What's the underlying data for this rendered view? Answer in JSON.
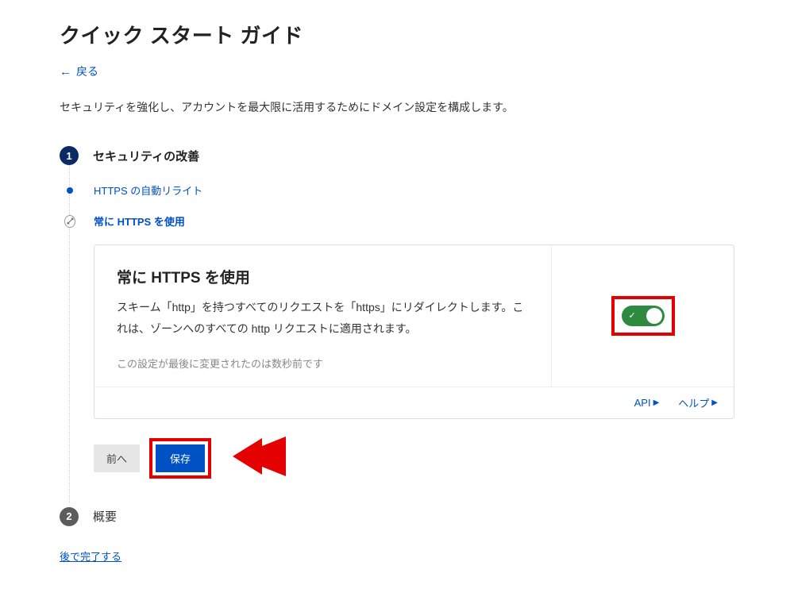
{
  "page": {
    "title": "クイック スタート ガイド",
    "back_label": "戻る",
    "intro": "セキュリティを強化し、アカウントを最大限に活用するためにドメイン設定を構成します。",
    "finish_later": "後で完了する"
  },
  "steps": {
    "s1": {
      "number": "1",
      "title": "セキュリティの改善"
    },
    "s2": {
      "number": "2",
      "title": "概要"
    }
  },
  "substeps": {
    "a": {
      "label": "HTTPS の自動リライト"
    },
    "b": {
      "label": "常に HTTPS を使用"
    }
  },
  "card": {
    "title": "常に HTTPS を使用",
    "description": "スキーム「http」を持つすべてのリクエストを「https」にリダイレクトします。これは、ゾーンへのすべての http リクエストに適用されます。",
    "meta": "この設定が最後に変更されたのは数秒前です",
    "toggle_state": "on",
    "footer": {
      "api": "API",
      "help": "ヘルプ"
    }
  },
  "buttons": {
    "prev": "前へ",
    "save": "保存"
  }
}
